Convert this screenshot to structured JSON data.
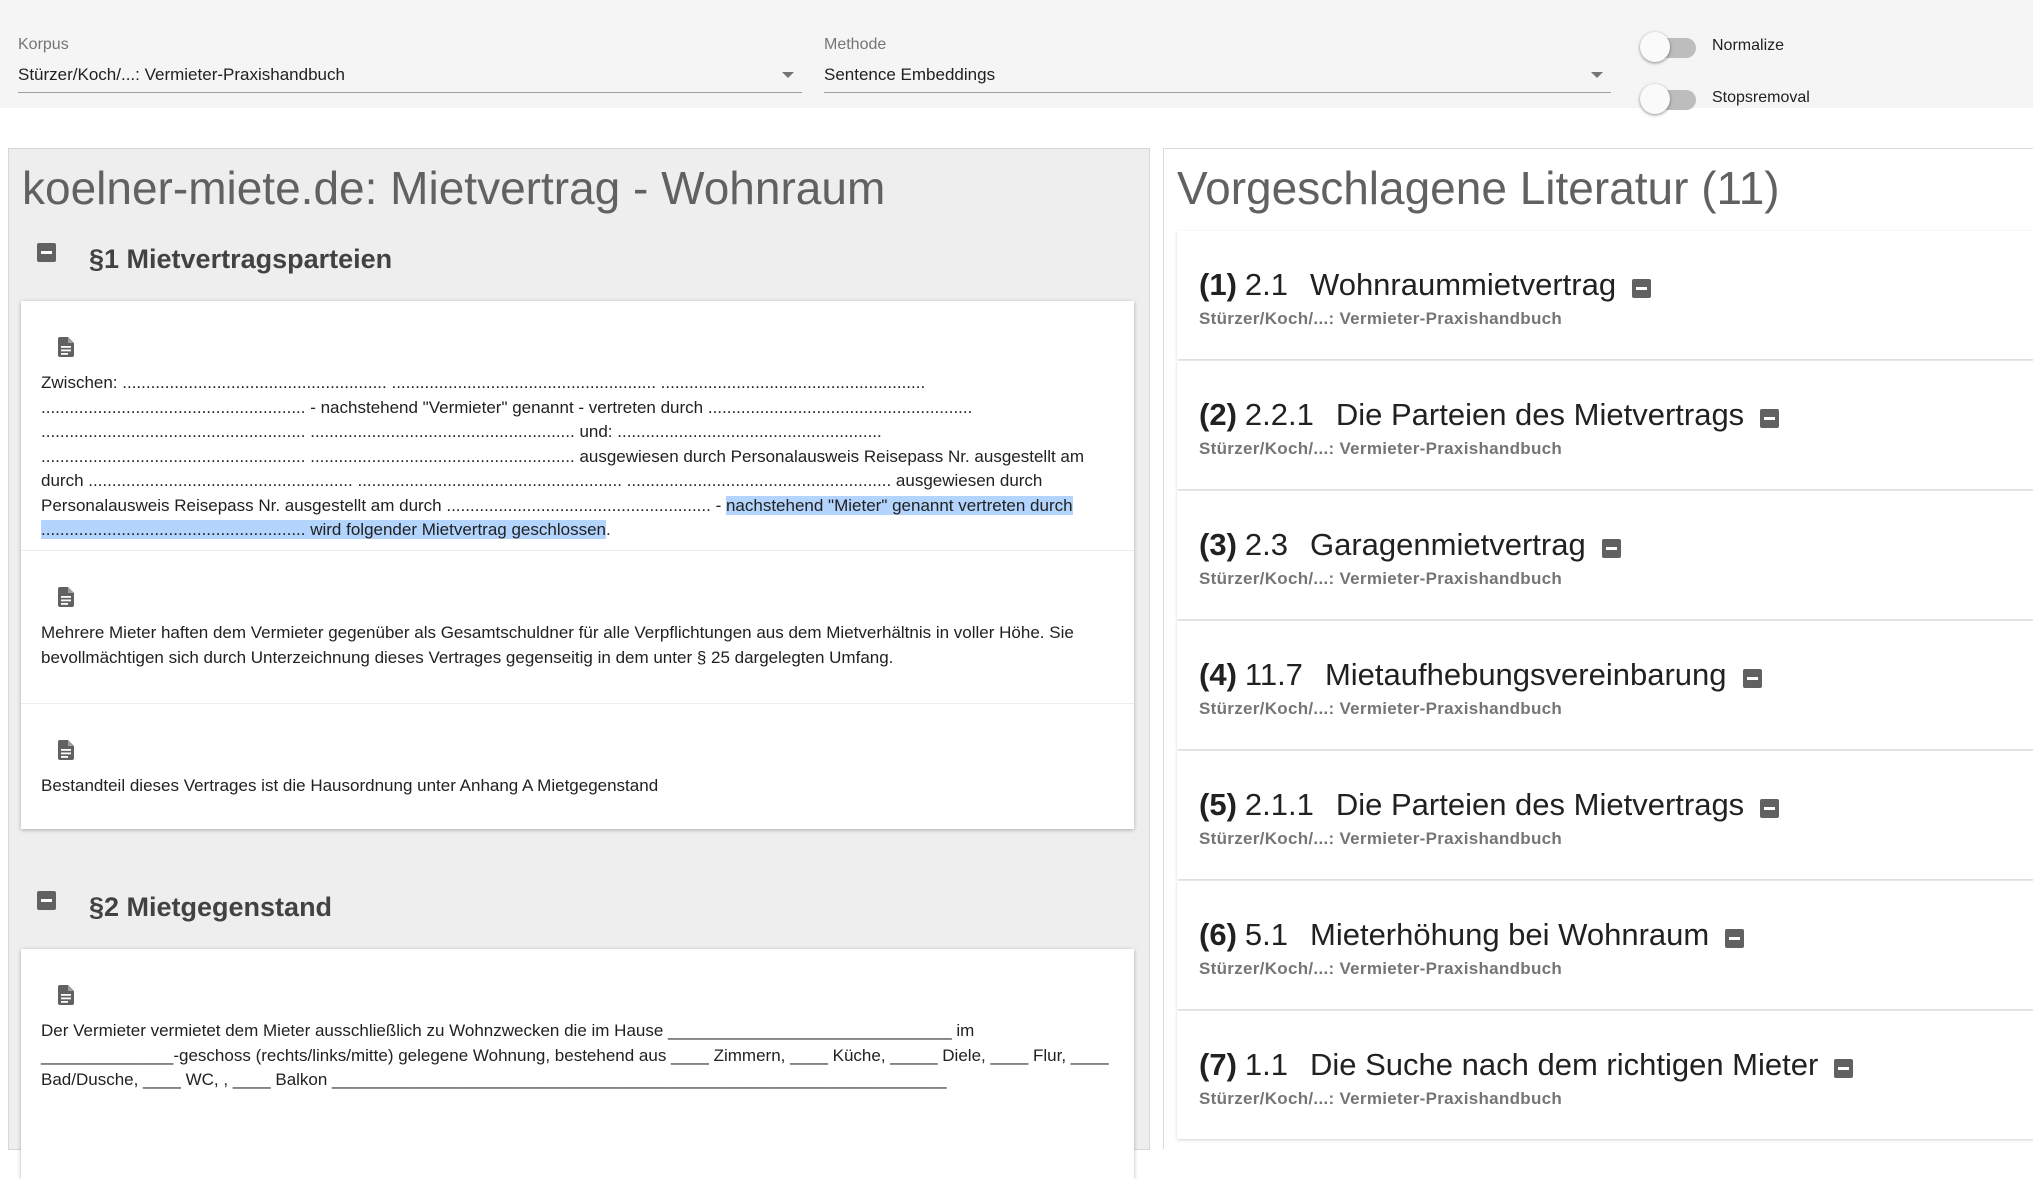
{
  "toolbar": {
    "korpus": {
      "label": "Korpus",
      "value": "Stürzer/Koch/...: Vermieter-Praxishandbuch"
    },
    "methode": {
      "label": "Methode",
      "value": "Sentence Embeddings"
    },
    "normalize": {
      "label": "Normalize",
      "on": false
    },
    "stopsremoval": {
      "label": "Stopsremoval",
      "on": false
    }
  },
  "document": {
    "title": "koelner-miete.de: Mietvertrag - Wohnraum",
    "sections": [
      {
        "title": "§1 Mietvertragsparteien",
        "paragraphs": [
          {
            "text_plain": "Zwischen: ........................................................ ........................................................ ........................................................ ........................................................ - nachstehend \"Vermieter\" genannt - vertreten durch ........................................................ ........................................................ ........................................................ und: ........................................................ ........................................................ ........................................................ ausgewiesen durch Personalausweis Reisepass Nr. ausgestellt am durch ........................................................ ........................................................ ........................................................ ausgewiesen durch Personalausweis Reisepass Nr. ausgestellt am durch ........................................................ - ",
            "text_highlight": "nachstehend \"Mieter\" genannt vertreten durch ........................................................ wird folgender Mietvertrag geschlossen",
            "text_after": "."
          },
          {
            "text": "Mehrere Mieter haften dem Vermieter gegenüber als Gesamtschuldner für alle Verpflichtungen aus dem Mietverhältnis in voller Höhe. Sie bevollmächtigen sich durch Unterzeichnung dieses Vertrages gegenseitig in dem unter § 25 dargelegten Umfang."
          },
          {
            "text": "Bestandteil dieses Vertrages ist die Hausordnung unter Anhang A Mietgegenstand"
          }
        ]
      },
      {
        "title": "§2 Mietgegenstand",
        "paragraphs": [
          {
            "text": "Der Vermieter vermietet dem Mieter ausschließlich zu Wohnzwecken die im Hause ______________________________ im ______________-geschoss (rechts/links/mitte) gelegene Wohnung, bestehend aus ____ Zimmern, ____ Küche, _____ Diele, ____ Flur, ____ Bad/Dusche, ____ WC, , ____ Balkon _________________________________________________________________"
          }
        ]
      }
    ]
  },
  "literature": {
    "title": "Vorgeschlagene Literatur (11)",
    "items": [
      {
        "num": "(1)",
        "section": "2.1",
        "name": "Wohnraummietvertrag",
        "source": "Stürzer/Koch/...: Vermieter-Praxishandbuch"
      },
      {
        "num": "(2)",
        "section": "2.2.1",
        "name": "Die Parteien des Mietvertrags",
        "source": "Stürzer/Koch/...: Vermieter-Praxishandbuch"
      },
      {
        "num": "(3)",
        "section": "2.3",
        "name": "Garagenmietvertrag",
        "source": "Stürzer/Koch/...: Vermieter-Praxishandbuch"
      },
      {
        "num": "(4)",
        "section": "11.7",
        "name": "Mietaufhebungsvereinbarung",
        "source": "Stürzer/Koch/...: Vermieter-Praxishandbuch"
      },
      {
        "num": "(5)",
        "section": "2.1.1",
        "name": "Die Parteien des Mietvertrags",
        "source": "Stürzer/Koch/...: Vermieter-Praxishandbuch"
      },
      {
        "num": "(6)",
        "section": "5.1",
        "name": "Mieterhöhung bei Wohnraum",
        "source": "Stürzer/Koch/...: Vermieter-Praxishandbuch"
      },
      {
        "num": "(7)",
        "section": "1.1",
        "name": "Die Suche nach dem richtigen Mieter",
        "source": "Stürzer/Koch/...: Vermieter-Praxishandbuch"
      }
    ]
  },
  "icons": {
    "document": "description-icon",
    "collapse": "collapse-icon",
    "dropdown": "dropdown-arrow-icon"
  }
}
